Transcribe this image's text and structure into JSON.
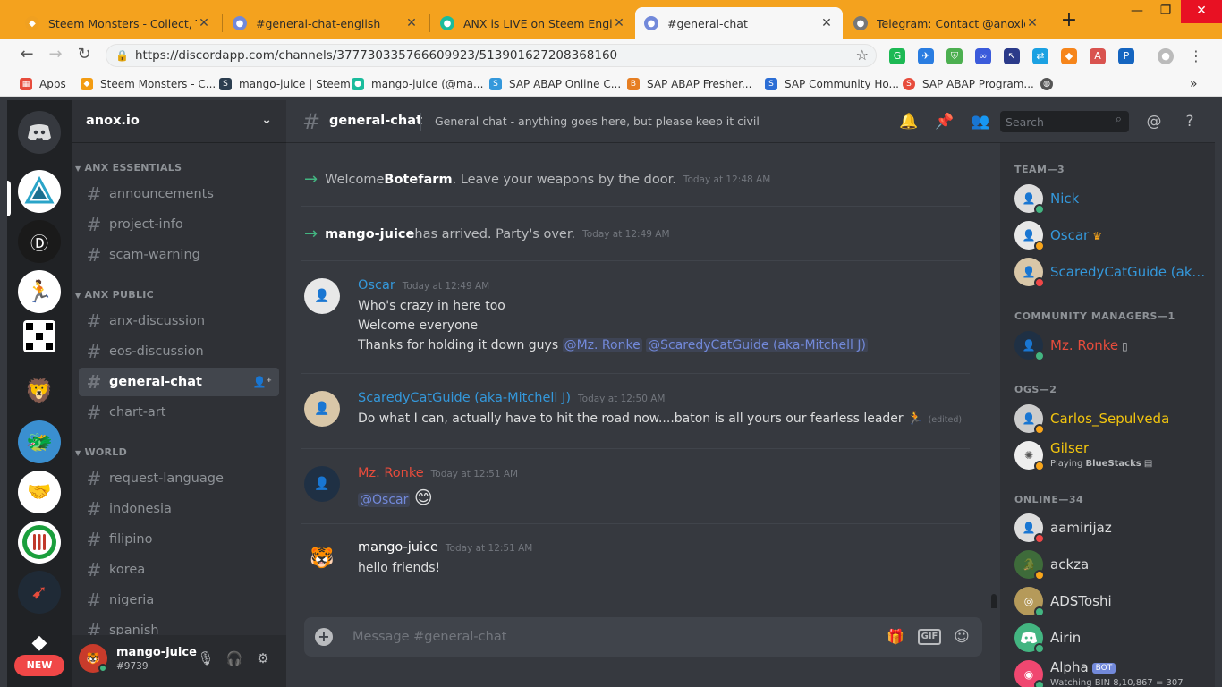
{
  "browser": {
    "tabs": [
      {
        "title": "Steem Monsters - Collect, Trade",
        "color": "#f4a21e"
      },
      {
        "title": "#general-chat-english",
        "color": "#7289da",
        "badge": "1"
      },
      {
        "title": "ANX is LIVE on Steem Engine ar",
        "color": "#1abc9c"
      },
      {
        "title": "#general-chat",
        "color": "#7289da"
      },
      {
        "title": "Telegram: Contact @anoxio",
        "color": "#666"
      }
    ],
    "url": "https://discordapp.com/channels/377730335766609923/513901627208368160",
    "bookmarks": [
      {
        "label": "Apps",
        "color": "#e74c3c"
      },
      {
        "label": "Steem Monsters - C...",
        "color": "#f39c12"
      },
      {
        "label": "mango-juice | Steem",
        "color": "#2c3e50"
      },
      {
        "label": "mango-juice (@ma...",
        "color": "#1abc9c"
      },
      {
        "label": "SAP ABAP Online C...",
        "color": "#3498db"
      },
      {
        "label": "SAP ABAP Fresher...",
        "color": "#e67e22"
      },
      {
        "label": "SAP Community Ho...",
        "color": "#2c6ed5"
      },
      {
        "label": "SAP ABAP Program...",
        "color": "#e74c3c"
      }
    ]
  },
  "servers": {
    "new_label": "NEW"
  },
  "sidebar": {
    "guild_name": "anox.io",
    "categories": [
      {
        "name": "ANX ESSENTIALS",
        "channels": [
          "announcements",
          "project-info",
          "scam-warning"
        ]
      },
      {
        "name": "ANX PUBLIC",
        "channels": [
          "anx-discussion",
          "eos-discussion",
          "general-chat",
          "chart-art"
        ]
      },
      {
        "name": "WORLD",
        "channels": [
          "request-language",
          "indonesia",
          "filipino",
          "korea",
          "nigeria",
          "spanish"
        ]
      }
    ],
    "user": {
      "name": "mango-juice",
      "tag": "#9739"
    }
  },
  "header": {
    "channel": "general-chat",
    "topic": "General chat - anything goes here, but please keep it civil",
    "search_placeholder": "Search"
  },
  "messages": {
    "sys1": {
      "pre": "Welcome ",
      "name": "Botefarm",
      "post": ". Leave your weapons by the door.",
      "time": "Today at 12:48 AM"
    },
    "sys2": {
      "name": "mango-juice",
      "post": " has arrived. Party's over.",
      "time": "Today at 12:49 AM"
    },
    "m1": {
      "author": "Oscar",
      "time": "Today at 12:49 AM",
      "line1": "Who's crazy in here too",
      "line2": "Welcome everyone",
      "line3": "Thanks for holding it down guys ",
      "mention1": "@Mz. Ronke",
      "mention2": "@ScaredyCatGuide (aka-Mitchell J)"
    },
    "m2": {
      "author": "ScaredyCatGuide (aka-Mitchell J)",
      "time": "Today at 12:50 AM",
      "line1": "Do what I can, actually have to hit the road now....baton is all yours our fearless leader ",
      "emoji": "🏃",
      "edited": "(edited)"
    },
    "m3": {
      "author": "Mz. Ronke",
      "time": "Today at 12:51 AM",
      "mention": "@Oscar",
      "emoji": "😊"
    },
    "m4": {
      "author": "mango-juice",
      "time": "Today at 12:51 AM",
      "line1": "hello friends!"
    }
  },
  "composer": {
    "placeholder": "Message #general-chat",
    "gif": "GIF"
  },
  "members": {
    "team_label": "TEAM—3",
    "team": [
      {
        "name": "Nick",
        "color": "#3498db"
      },
      {
        "name": "Oscar",
        "color": "#3498db"
      },
      {
        "name": "ScaredyCatGuide (aka-...",
        "color": "#3498db"
      }
    ],
    "cm_label": "COMMUNITY MANAGERS—1",
    "cm": [
      {
        "name": "Mz. Ronke",
        "color": "#e74c3c"
      }
    ],
    "ogs_label": "OGS—2",
    "ogs": [
      {
        "name": "Carlos_Sepulveda",
        "color": "#f1c40f"
      },
      {
        "name": "Gilser",
        "color": "#f1c40f",
        "activity_pre": "Playing ",
        "activity": "BlueStacks"
      }
    ],
    "online_label": "ONLINE—34",
    "online": [
      {
        "name": "aamirijaz"
      },
      {
        "name": "ackza"
      },
      {
        "name": "ADSToshi"
      },
      {
        "name": "Airin"
      },
      {
        "name": "Alpha",
        "badge": "BOT",
        "activity": "Watching BIN 8,10,867 = 307"
      }
    ]
  }
}
